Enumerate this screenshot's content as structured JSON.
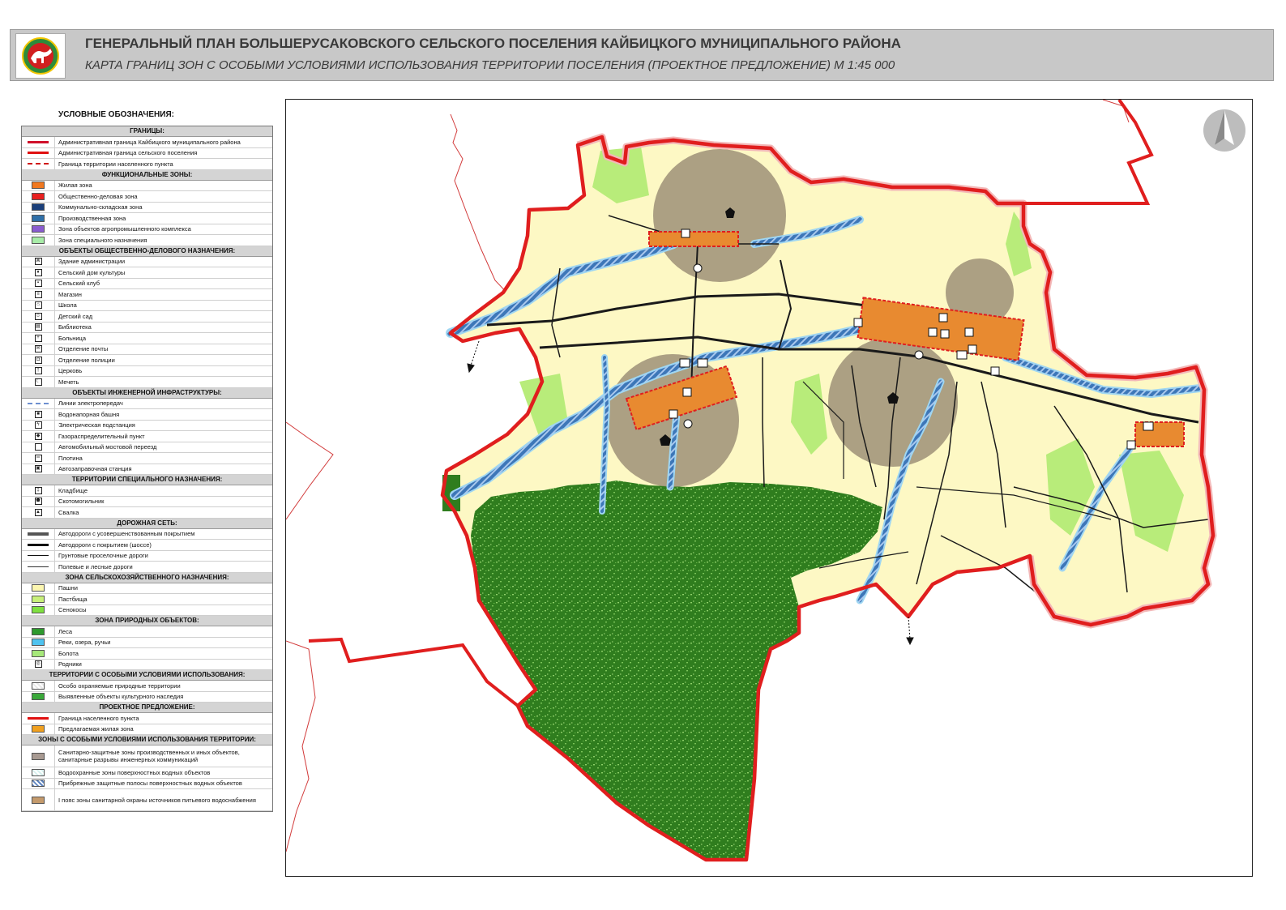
{
  "header": {
    "title": "ГЕНЕРАЛЬНЫЙ ПЛАН БОЛЬШЕРУСАКОВСКОГО СЕЛЬСКОГО ПОСЕЛЕНИЯ КАЙБИЦКОГО МУНИЦИПАЛЬНОГО РАЙОНА",
    "subtitle": "КАРТА ГРАНИЦ ЗОН С ОСОБЫМИ УСЛОВИЯМИ ИСПОЛЬЗОВАНИЯ ТЕРРИТОРИИ ПОСЕЛЕНИЯ (ПРОЕКТНОЕ ПРЕДЛОЖЕНИЕ)  М 1:45 000"
  },
  "legend": {
    "heading": "УСЛОВНЫЕ ОБОЗНАЧЕНИЯ:",
    "sections": [
      {
        "title": "ГРАНИЦЫ:",
        "items": [
          {
            "label": "Административная граница Кайбицкого муниципального района",
            "kind": "line",
            "color": "#d0102a"
          },
          {
            "label": "Административная граница сельского поселения",
            "kind": "line",
            "color": "#e01010"
          },
          {
            "label": "Граница территории населенного пункта",
            "kind": "dashline",
            "color": "#d01010"
          }
        ]
      },
      {
        "title": "ФУНКЦИОНАЛЬНЫЕ ЗОНЫ:",
        "items": [
          {
            "label": "Жилая зона",
            "kind": "swatch",
            "color": "#f07820"
          },
          {
            "label": "Общественно-деловая зона",
            "kind": "swatch",
            "color": "#e82020"
          },
          {
            "label": "Коммунально-складская зона",
            "kind": "swatch",
            "color": "#1a3f7a"
          },
          {
            "label": "Производственная зона",
            "kind": "swatch",
            "color": "#2f6fa8"
          },
          {
            "label": "Зона объектов агропромышленного комплекса",
            "kind": "swatch",
            "color": "#8a5cd0"
          },
          {
            "label": "Зона специального назначения",
            "kind": "swatch",
            "color": "#a8eca8"
          }
        ]
      },
      {
        "title": "ОБЪЕКТЫ ОБЩЕСТВЕННО-ДЕЛОВОГО НАЗНАЧЕНИЯ:",
        "items": [
          {
            "label": "Здание администрации",
            "kind": "icon",
            "glyph": "⌘"
          },
          {
            "label": "Сельский дом культуры",
            "kind": "icon",
            "glyph": "♦"
          },
          {
            "label": "Сельский клуб",
            "kind": "icon",
            "glyph": "▪"
          },
          {
            "label": "Магазин",
            "kind": "icon",
            "glyph": "≡"
          },
          {
            "label": "Школа",
            "kind": "icon",
            "glyph": "⌂"
          },
          {
            "label": "Детский сад",
            "kind": "icon",
            "glyph": "☺"
          },
          {
            "label": "Библиотека",
            "kind": "icon",
            "glyph": "▤"
          },
          {
            "label": "Больница",
            "kind": "icon",
            "glyph": "+"
          },
          {
            "label": "Отделение почты",
            "kind": "icon",
            "glyph": "✉"
          },
          {
            "label": "Отделение полиции",
            "kind": "icon",
            "glyph": "◘"
          },
          {
            "label": "Церковь",
            "kind": "icon",
            "glyph": "†"
          },
          {
            "label": "Мечеть",
            "kind": "icon",
            "glyph": "☾"
          }
        ]
      },
      {
        "title": "ОБЪЕКТЫ ИНЖЕНЕРНОЙ ИНФРАСТРУКТУРЫ:",
        "items": [
          {
            "label": "Линии электропередач",
            "kind": "dashline",
            "color": "#6d8fd0"
          },
          {
            "label": "Водонапорная башня",
            "kind": "icon",
            "glyph": "■"
          },
          {
            "label": "Электрическая подстанция",
            "kind": "icon",
            "glyph": "ϟ"
          },
          {
            "label": "Газораспределительный пункт",
            "kind": "icon",
            "glyph": "◆"
          },
          {
            "label": "Автомобильный мостовой переезд",
            "kind": "icon",
            "glyph": ""
          },
          {
            "label": "Плотина",
            "kind": "icon",
            "glyph": "═"
          },
          {
            "label": "Автозаправочная станция",
            "kind": "icon",
            "glyph": "▣"
          }
        ]
      },
      {
        "title": "ТЕРРИТОРИИ СПЕЦИАЛЬНОГО НАЗНАЧЕНИЯ:",
        "items": [
          {
            "label": "Кладбище",
            "kind": "icon",
            "glyph": "‡"
          },
          {
            "label": "Скотомогильник",
            "kind": "icon",
            "glyph": "⬟"
          },
          {
            "label": "Свалка",
            "kind": "icon",
            "glyph": "▲"
          }
        ]
      },
      {
        "title": "ДОРОЖНАЯ СЕТЬ:",
        "items": [
          {
            "label": "Автодороги с усовершенствованным покрытием",
            "kind": "thickline",
            "color": "#555555"
          },
          {
            "label": "Автодороги с покрытием (шоссе)",
            "kind": "line",
            "color": "#111111"
          },
          {
            "label": "Грунтовые проселочные дороги",
            "kind": "thinline",
            "color": "#111111"
          },
          {
            "label": "Полевые и лесные дороги",
            "kind": "thinline",
            "color": "#333333"
          }
        ]
      },
      {
        "title": "ЗОНА СЕЛЬСКОХОЗЯЙСТВЕННОГО НАЗНАЧЕНИЯ:",
        "items": [
          {
            "label": "Пашни",
            "kind": "swatch",
            "color": "#fbf6b0"
          },
          {
            "label": "Пастбища",
            "kind": "swatch",
            "color": "#c8f07a"
          },
          {
            "label": "Сенокосы",
            "kind": "swatch",
            "color": "#7fe040"
          }
        ]
      },
      {
        "title": "ЗОНА ПРИРОДНЫХ ОБЪЕКТОВ:",
        "items": [
          {
            "label": "Леса",
            "kind": "swatch",
            "color": "#2e9a2e"
          },
          {
            "label": "Реки, озера, ручьи",
            "kind": "swatch",
            "color": "#4fc3f0"
          },
          {
            "label": "Болота",
            "kind": "swatch",
            "color": "#a6e87a"
          },
          {
            "label": "Родники",
            "kind": "icon",
            "glyph": "◎"
          }
        ]
      },
      {
        "title": "ТЕРРИТОРИИ С ОСОБЫМИ УСЛОВИЯМИ ИСПОЛЬЗОВАНИЯ:",
        "items": [
          {
            "label": "Особо охраняемые природные территории",
            "kind": "hatch",
            "color": "#e8e8e8"
          },
          {
            "label": "Выявленные объекты культурного наследия",
            "kind": "swatch",
            "color": "#3aa83a"
          }
        ]
      },
      {
        "title": "ПРОЕКТНОЕ ПРЕДЛОЖЕНИЕ:",
        "items": [
          {
            "label": "Граница населенного пункта",
            "kind": "line",
            "color": "#e01010"
          },
          {
            "label": "Предлагаемая жилая зона",
            "kind": "swatch",
            "color": "#f0a020"
          }
        ]
      },
      {
        "title": "ЗОНЫ С ОСОБЫМИ УСЛОВИЯМИ ИСПОЛЬЗОВАНИЯ ТЕРРИТОРИИ:",
        "items": [
          {
            "label": "Санитарно-защитные зоны производственных и иных объектов, санитарные разрывы инженерных коммуникаций",
            "kind": "swatch",
            "color": "#a89a92",
            "tall": true
          },
          {
            "label": "Водоохранные зоны поверхностных водных объектов",
            "kind": "hatch",
            "color": "#d6f0ee"
          },
          {
            "label": "Прибрежные защитные полосы поверхностных водных объектов",
            "kind": "hatch",
            "color": "#5d84c0"
          },
          {
            "label": "I пояс зоны санитарной охраны источников питьевого водоснабжения",
            "kind": "swatch",
            "color": "#c49a6c",
            "tall": true
          }
        ]
      }
    ]
  },
  "map": {
    "colors": {
      "arable": "#fdf8c4",
      "forest": "#2f7d1e",
      "forest_dots": "#8fd06a",
      "meadow": "#b8ec7a",
      "river": "#3d77b8",
      "river_edge": "#9fd6f2",
      "boundary": "#e01e1e",
      "boundary_halo": "#f3b8b8",
      "sanitary": "#8c7e6a",
      "roads": "#1a1a1a",
      "residential": "#e88a30",
      "outer_line": "#d23b3b"
    },
    "north_arrow": "north-arrow-icon"
  }
}
